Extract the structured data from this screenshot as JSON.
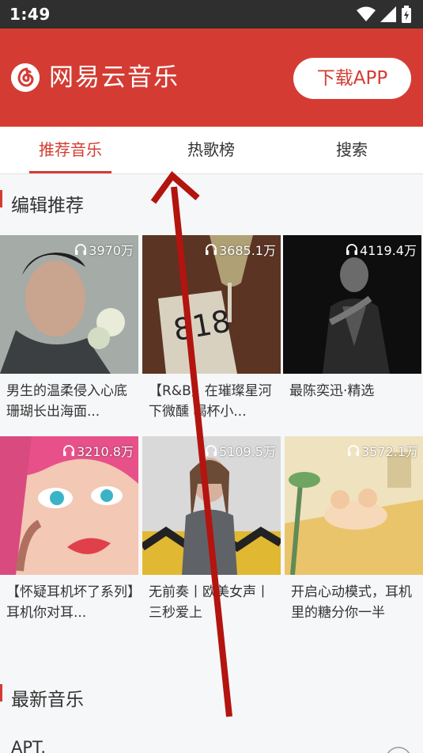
{
  "status_bar": {
    "time": "1:49",
    "icons": [
      "wifi-icon",
      "signal-icon",
      "battery-icon"
    ]
  },
  "header": {
    "app_name": "网易云音乐",
    "download_label": "下载APP",
    "brand_color": "#d43c33"
  },
  "tabs": [
    {
      "label": "推荐音乐",
      "active": true
    },
    {
      "label": "热歌榜",
      "active": false
    },
    {
      "label": "搜索",
      "active": false
    }
  ],
  "sections": {
    "editor_pick": "编辑推荐",
    "new_music": "最新音乐"
  },
  "playlists": [
    {
      "play_count": "3970万",
      "title": "男生的温柔侵入心底 珊瑚长出海面..."
    },
    {
      "play_count": "3685.1万",
      "title": "【R&B】在璀璨星河下微醺 喝杯小..."
    },
    {
      "play_count": "4119.4万",
      "title": "最陈奕迅·精选"
    },
    {
      "play_count": "3210.8万",
      "title": "【怀疑耳机坏了系列】耳机你对耳..."
    },
    {
      "play_count": "5109.5万",
      "title": "无前奏丨欧美女声丨三秒爱上"
    },
    {
      "play_count": "3572.1万",
      "title": "开启心动模式，耳机里的糖分你一半"
    }
  ],
  "new_songs": [
    {
      "name": "APT."
    }
  ]
}
